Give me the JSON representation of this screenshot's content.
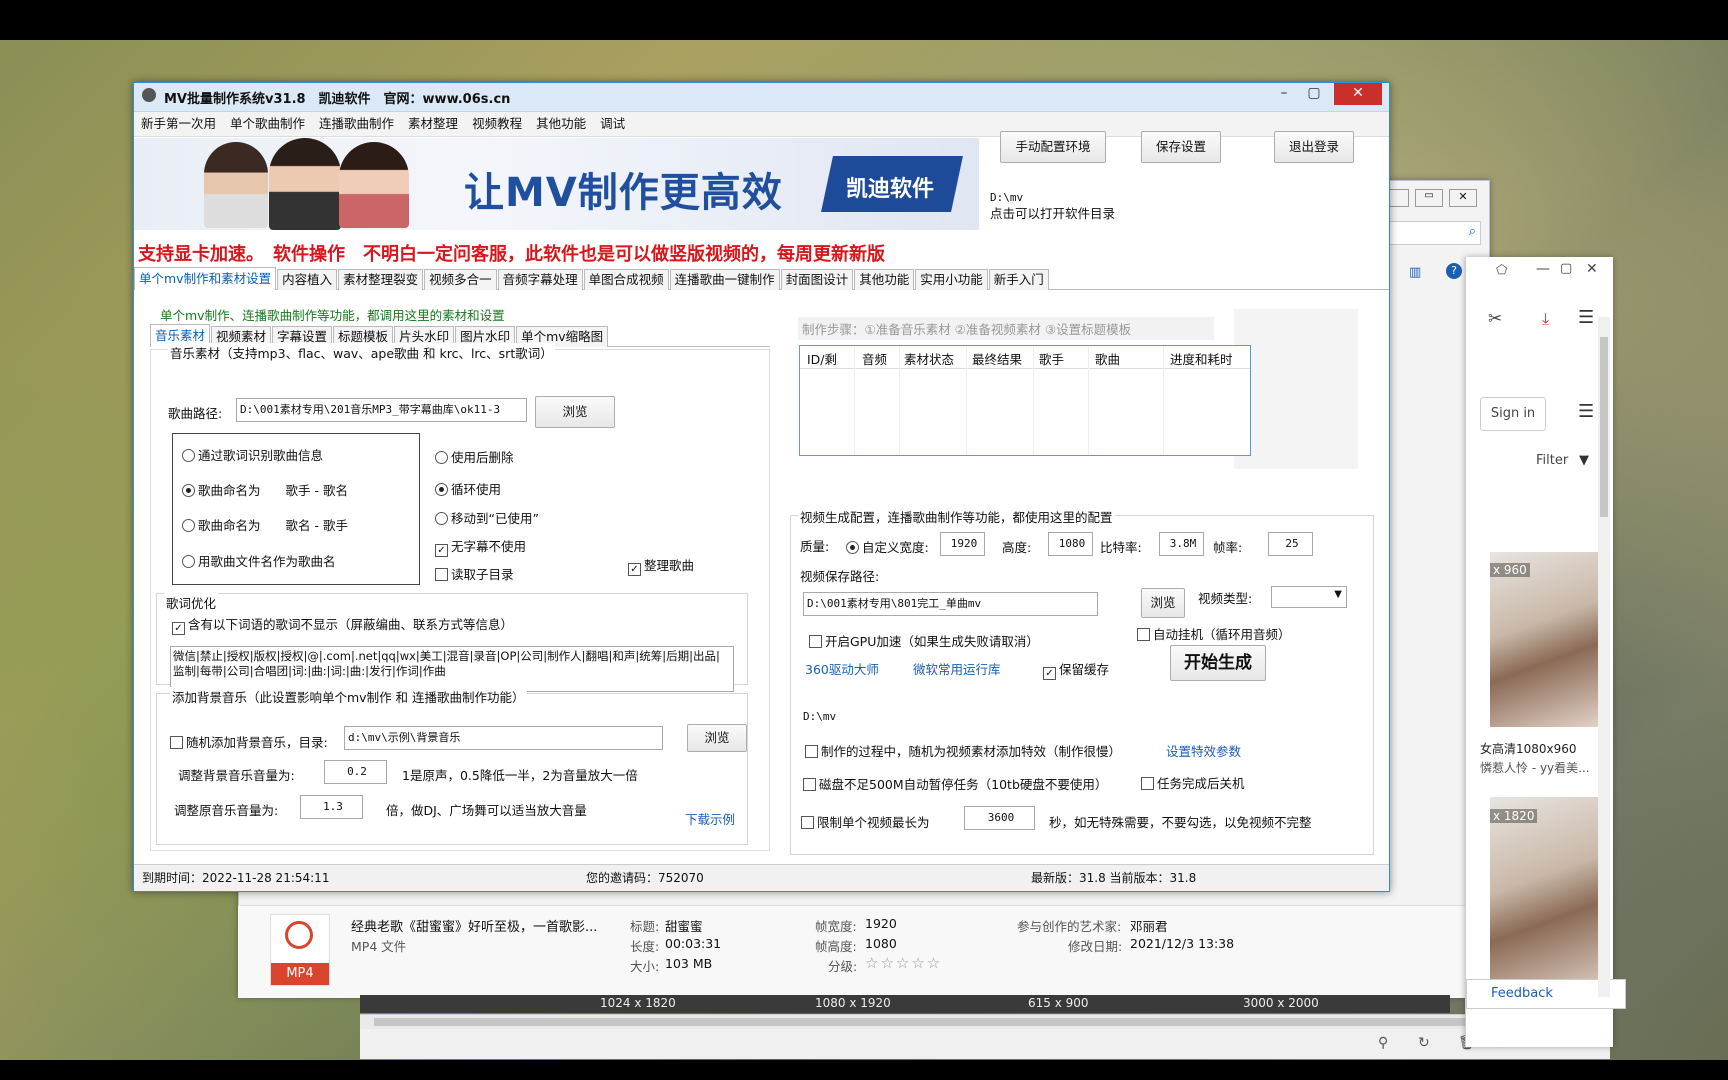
{
  "window": {
    "title": "MV批量制作系统v31.8　凯迪软件　官网：www.06s.cn"
  },
  "menu": [
    "新手第一次用",
    "单个歌曲制作",
    "连播歌曲制作",
    "素材整理",
    "视频教程",
    "其他功能",
    "调试"
  ],
  "banner": {
    "slogan": "让MV制作更高效",
    "brand": "凯迪软件"
  },
  "top_buttons": {
    "config": "手动配置环境",
    "save": "保存设置",
    "logout": "退出登录"
  },
  "dir": {
    "path": "D:\\mv",
    "hint": "点击可以打开软件目录"
  },
  "notice": "支持显卡加速。　软件操作　不明白一定问客服，此软件也是可以做竖版视频的，每周更新新版",
  "main_tabs": [
    "单个mv制作和素材设置",
    "内容植入",
    "素材整理裂变",
    "视频多合一",
    "音频字幕处理",
    "单图合成视频",
    "连播歌曲一键制作",
    "封面图设计",
    "其他功能",
    "实用小功能",
    "新手入门"
  ],
  "hint_line": "单个mv制作、连播歌曲制作等功能，都调用这里的素材和设置",
  "sub_tabs": [
    "音乐素材",
    "视频素材",
    "字幕设置",
    "标题模板",
    "片头水印",
    "图片水印",
    "单个mv缩略图"
  ],
  "music": {
    "group_title": "音乐素材（支持mp3、flac、wav、ape歌曲 和 krc、lrc、srt歌词）",
    "path_label": "歌曲路径:",
    "path_value": "D:\\001素材专用\\201音乐MP3_带字幕曲库\\ok11-3",
    "browse": "浏览",
    "radios": [
      "通过歌词识别歌曲信息",
      "歌曲命名为　　歌手 - 歌名",
      "歌曲命名为　　歌名 - 歌手",
      "用歌曲文件名作为歌曲名"
    ],
    "after_use": [
      "使用后删除",
      "循环使用",
      "移动到“已使用”"
    ],
    "no_sub": "无字幕不使用",
    "read_sub": "读取子目录",
    "organize": "整理歌曲"
  },
  "lyrics": {
    "title": "歌词优化",
    "check": "含有以下词语的歌词不显示（屏蔽编曲、联系方式等信息）",
    "words": "微信|禁止|授权|版权|授权|@|.com|.net|qq|wx|美工|混音|录音|OP|公司|制作人|翻唱|和声|统筹|后期|出品|监制|每带|公司|合唱团|词:|曲:|词:|曲:|发行|作词|作曲"
  },
  "bgm": {
    "title": "添加背景音乐（此设置影响单个mv制作 和 连播歌曲制作功能）",
    "random_label": "随机添加背景音乐，目录:",
    "dir_value": "d:\\mv\\示例\\背景音乐",
    "browse": "浏览",
    "bgm_vol_label": "调整背景音乐音量为:",
    "bgm_vol": "0.2",
    "bgm_vol_note": "1是原声，0.5降低一半，2为音量放大一倍",
    "orig_vol_label": "调整原音乐音量为:",
    "orig_vol": "1.3",
    "orig_vol_note": "倍，做DJ、广场舞可以适当放大音量",
    "download": "下载示例"
  },
  "steps": "制作步骤：①准备音乐素材 ②准备视频素材 ③设置标题模板",
  "table_headers": [
    "ID/剩",
    "音频",
    "素材状态",
    "最终结果",
    "歌手",
    "歌曲",
    "进度和耗时"
  ],
  "video": {
    "title": "视频生成配置，连播歌曲制作等功能，都使用这里的配置",
    "quality_label": "质量:",
    "custom_width": "自定义宽度:",
    "width": "1920",
    "height_label": "高度:",
    "height": "1080",
    "bitrate_label": "比特率:",
    "bitrate": "3.8M",
    "fps_label": "帧率:",
    "fps": "25",
    "save_path_label": "视频保存路径:",
    "save_path": "D:\\001素材专用\\801完工_单曲mv",
    "browse": "浏览",
    "type_label": "视频类型:",
    "gpu": "开启GPU加速（如果生成失败请取消）",
    "auto_hang": "自动挂机（循环用音频）",
    "link_360": "360驱动大师",
    "link_ms": "微软常用运行库",
    "keep_cache": "保留缓存",
    "start": "开始生成",
    "dir": "D:\\mv",
    "random_fx": "制作的过程中，随机为视频素材添加特效（制作很慢）",
    "fx_params": "设置特效参数",
    "disk_pause": "磁盘不足500M自动暂停任务（10tb硬盘不要使用）",
    "shutdown": "任务完成后关机",
    "limit_label": "限制单个视频最长为",
    "limit_value": "3600",
    "limit_note": "秒，如无特殊需要，不要勾选，以免视频不完整"
  },
  "status": {
    "expire": "到期时间：2022-11-28 21:54:11",
    "invite": "您的邀请码：752070",
    "version": "最新版：31.8 当前版本：31.8"
  },
  "explorer_details": {
    "file_title": "经典老歌《甜蜜蜜》好听至极，一首歌影...",
    "file_type": "MP4 文件",
    "icon_label": "MP4",
    "title_label": "标题:",
    "title_value": "甜蜜蜜",
    "length_label": "长度:",
    "length_value": "00:03:31",
    "size_label": "大小:",
    "size_value": "103 MB",
    "fw_label": "帧宽度:",
    "fw_value": "1920",
    "fh_label": "帧高度:",
    "fh_value": "1080",
    "rating_label": "分级:",
    "artist_label": "参与创作的艺术家:",
    "artist_value": "邓丽君",
    "modified_label": "修改日期:",
    "modified_value": "2021/12/3 13:38"
  },
  "browser": {
    "signin": "Sign in",
    "filter": "Filter",
    "dim1": "x 960",
    "caption1": "女高清1080x960",
    "caption2": "憐惹人怜 - yy看美...",
    "dim2": "x 1820",
    "feedback": "Feedback"
  },
  "thumb_dims": [
    "1024 x 1820",
    "1080 x 1920",
    "615 x 900",
    "3000 x 2000"
  ]
}
